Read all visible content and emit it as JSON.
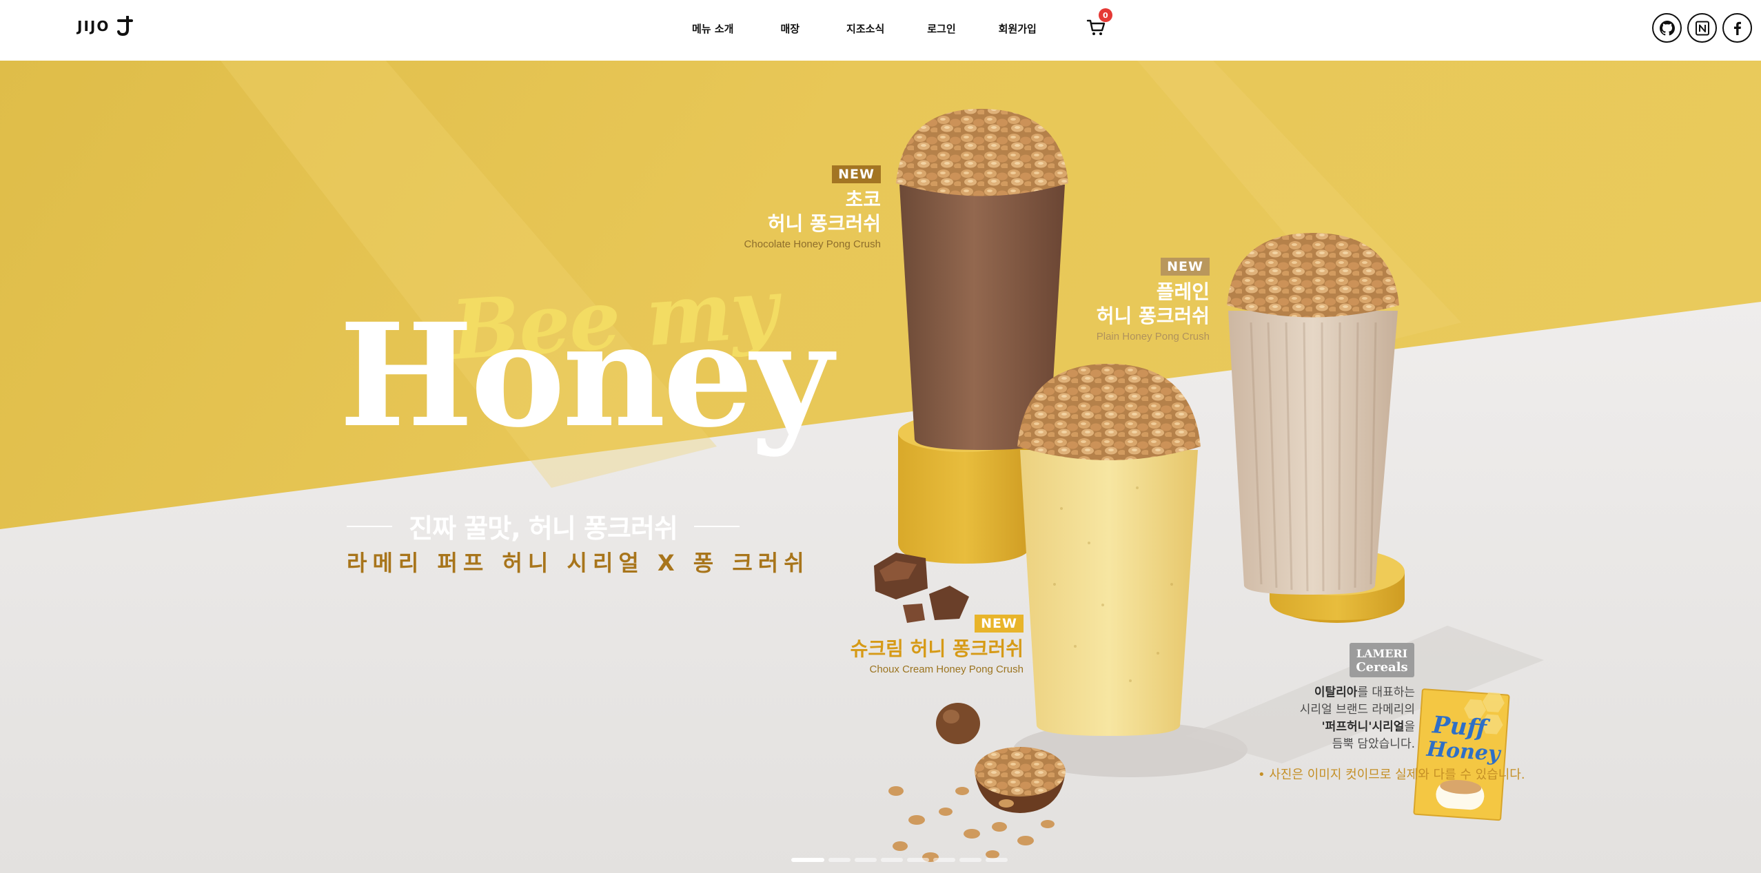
{
  "header": {
    "logo_text": "JIJO",
    "nav": [
      {
        "label": "메뉴 소개"
      },
      {
        "label": "매장"
      },
      {
        "label": "지조소식"
      },
      {
        "label": "로그인"
      },
      {
        "label": "회원가입"
      }
    ],
    "cart_count": "0",
    "socials": [
      "github-icon",
      "notion-icon",
      "facebook-icon"
    ]
  },
  "hero": {
    "script_title": "Bee my",
    "main_title": "Honey",
    "tagline": "진짜 꿀맛, 허니 퐁크러쉬",
    "sub_tagline": "라메리 퍼프 허니 시리얼 X 퐁 크러쉬",
    "products": [
      {
        "badge": "NEW",
        "name": "초코\n허니 퐁크러쉬",
        "english": "Chocolate Honey Pong Crush"
      },
      {
        "badge": "NEW",
        "name": "플레인\n허니 퐁크러쉬",
        "english": "Plain Honey Pong Crush"
      },
      {
        "badge": "NEW",
        "name": "슈크림 허니 퐁크러쉬",
        "english": "Choux Cream Honey Pong Crush"
      }
    ],
    "brand": {
      "logo_line1": "LAMERI",
      "logo_line2": "Cereals",
      "desc_1a": "이탈리아",
      "desc_1b": "를 대표하는",
      "desc_2": "시리얼 브랜드 라메리의",
      "desc_3a": "'퍼프허니'시리얼",
      "desc_3b": "을",
      "desc_4": "듬뿍 담았습니다.",
      "box_line1": "Puff",
      "box_line2": "Honey"
    },
    "disclaimer": "• 사진은 이미지 컷이므로 실제와 다를 수 있습니다.",
    "slides": 8,
    "active_slide": 1
  },
  "colors": {
    "wall": "#e6c552",
    "floor": "#e9e6e4",
    "accent_gold": "#a37523",
    "badge_red": "#e53935"
  }
}
